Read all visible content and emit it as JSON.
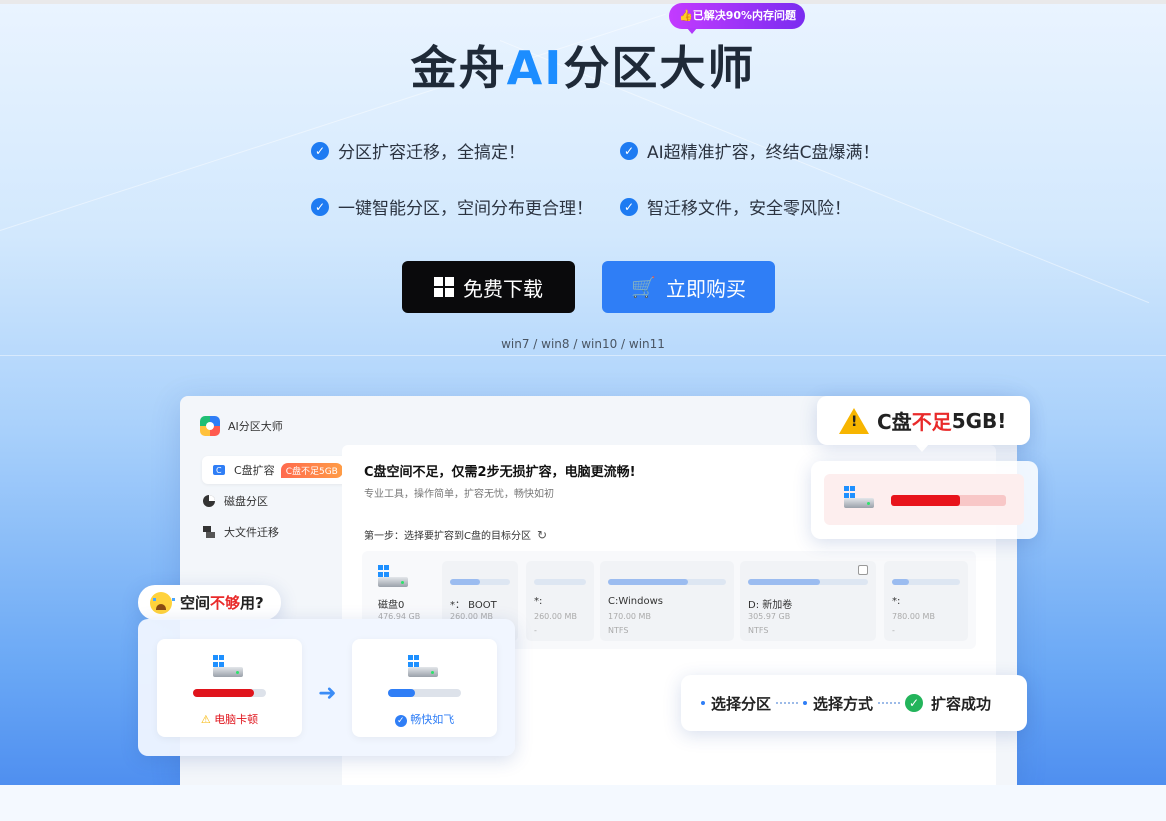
{
  "hero": {
    "title_pre": "金舟",
    "title_ai": "AI",
    "title_post": "分区大师",
    "solved_badge": "👍已解决90%内存问题",
    "features": [
      "分区扩容迁移，全搞定！",
      "AI超精准扩容，终结C盘爆满！",
      "一键智能分区，空间分布更合理！",
      "智迁移文件，安全零风险！"
    ],
    "download_label": "免费下载",
    "buy_label": "立即购买",
    "os_note": "win7 / win8 / win10 / win11"
  },
  "app": {
    "name": "AI分区大师",
    "sidebar": [
      {
        "label": "C盘扩容",
        "badge": "C盘不足5GB"
      },
      {
        "label": "磁盘分区"
      },
      {
        "label": "大文件迁移"
      }
    ],
    "content_title": "C盘空间不足，仅需2步无损扩容，电脑更流畅!",
    "content_sub": "专业工具，操作简单，扩容无忧，畅快如初",
    "step_label": "第一步：选择要扩容到C盘的目标分区",
    "disk": {
      "name": "磁盘0",
      "size": "476.94 GB"
    },
    "partitions": [
      {
        "name": "*： BOOT",
        "size": "260.00 MB",
        "fs": "",
        "usage": 0.5
      },
      {
        "name": "*:",
        "size": "260.00 MB",
        "fs": "-",
        "usage": 0.0
      },
      {
        "name": "C:Windows",
        "size": "170.00 MB",
        "fs": "NTFS",
        "usage": 0.68
      },
      {
        "name": "D: 新加卷",
        "size": "305.97 GB",
        "fs": "NTFS",
        "usage": 0.6
      },
      {
        "name": "*:",
        "size": "780.00 MB",
        "fs": "-",
        "usage": 0.25
      }
    ]
  },
  "callouts": {
    "warn_pre": "C盘",
    "warn_red": "不足",
    "warn_post": "5GB!",
    "c_drive_usage": 0.6,
    "space_pre": "空间",
    "space_red": "不够",
    "space_post": "用?",
    "before_label": "电脑卡顿",
    "before_usage": 0.84,
    "after_label": "畅快如飞",
    "after_usage": 0.37,
    "step1": "选择分区",
    "step2": "选择方式",
    "step3": "扩容成功"
  },
  "colors": {
    "accent": "#2f7ef6",
    "warning": "#e92a2a",
    "success": "#23b45b"
  }
}
